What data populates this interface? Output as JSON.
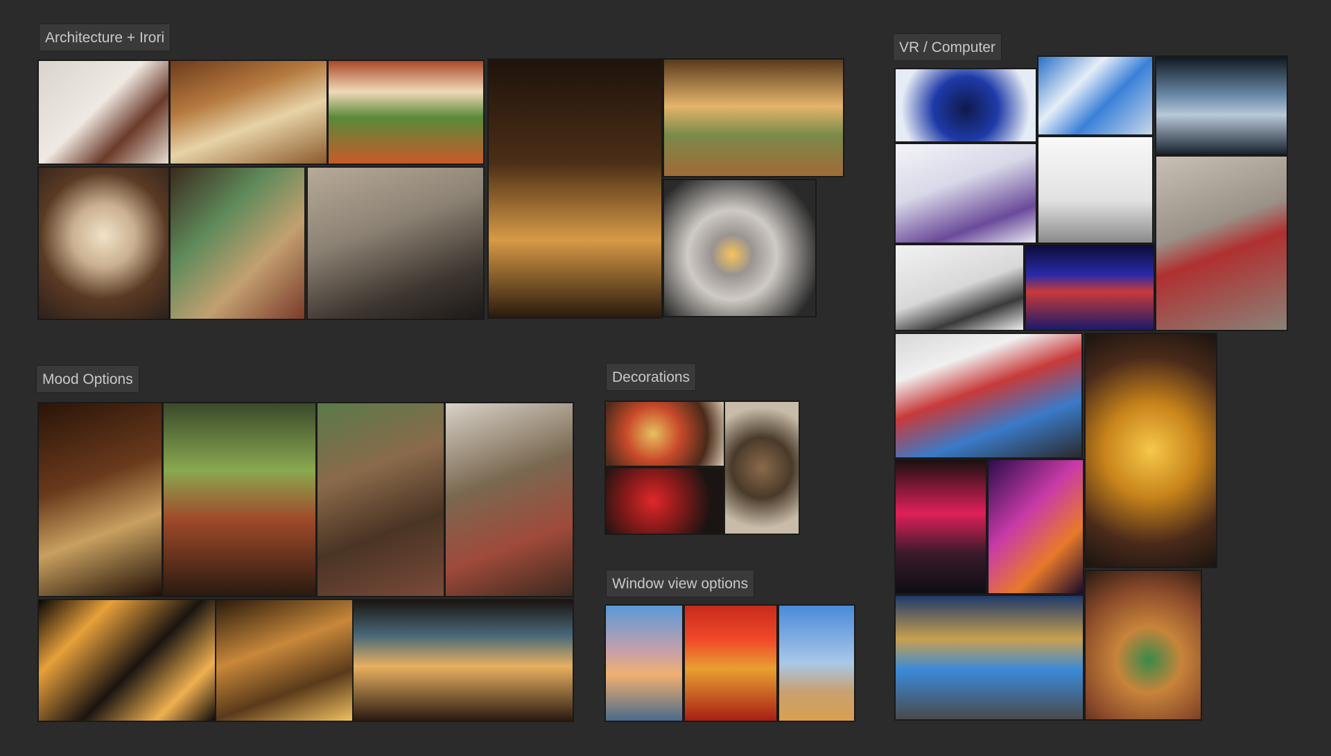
{
  "groups": {
    "architecture": {
      "title": "Architecture + Irori",
      "images": [
        {
          "name": "circle-window-living-room-image",
          "bg": "linear-gradient(135deg,#d9d4cc 0%,#efe9e2 45%,#6b3a2a 70%,#e6ddd0 100%)"
        },
        {
          "name": "tatami-garden-room-image",
          "bg": "linear-gradient(160deg,#6e3b1c 0%,#b57a3f 35%,#e7d3a8 60%,#8b5a2b 100%)"
        },
        {
          "name": "shoji-garden-view-image",
          "bg": "linear-gradient(180deg,#a84a2a 0%,#f1d9b8 30%,#5a8a3a 55%,#c85a2a 100%)"
        },
        {
          "name": "dark-irori-hall-image",
          "bg": "linear-gradient(180deg,#1e130b 0%,#4b2e16 40%,#d79a46 70%,#2a1a0e 100%)"
        },
        {
          "name": "hanging-hood-irori-room-image",
          "bg": "linear-gradient(180deg,#5a3a1e 0%,#e4b46a 40%,#7a8a4a 65%,#a06a36 100%)"
        },
        {
          "name": "round-moon-door-bonsai-image",
          "bg": "radial-gradient(circle at 50% 45%,#f2e2c8 0%,#c9b090 30%,#5a3a24 60%,#2c2019 100%)"
        },
        {
          "name": "green-moon-bedroom-image",
          "bg": "linear-gradient(135deg,#3a2a1c 0%,#5f8a5a 35%,#c2a070 65%,#7a3a2a 100%)"
        },
        {
          "name": "sunken-tatami-irori-image",
          "bg": "linear-gradient(160deg,#b8aa98 0%,#8c8274 40%,#3e3630 75%,#1e1a18 100%)"
        },
        {
          "name": "circular-fire-pit-lounge-image",
          "bg": "radial-gradient(circle at 45% 55%,#f6c35a 0%,#9a9490 18%,#cfcac4 40%,#2a2a2a 80%)"
        }
      ]
    },
    "vr_computer": {
      "title": "VR / Computer",
      "images": [
        {
          "name": "vr-pod-chair-image",
          "bg": "radial-gradient(circle at 50% 55%,#0f1a4a 0%,#1e3aa8 40%,#e6ecf5 80%)"
        },
        {
          "name": "vr-flight-rig-image",
          "bg": "linear-gradient(135deg,#2a70c8 0%,#e6eef8 35%,#3a80d8 60%,#c8d8ea 100%)"
        },
        {
          "name": "server-cables-image",
          "bg": "linear-gradient(180deg,#101820 0%,#6a8aa8 40%,#b8c8d8 60%,#1a2430 100%)"
        },
        {
          "name": "vr-swing-arcade-image",
          "bg": "linear-gradient(160deg,#f4f4f8 0%,#d8d8e8 40%,#6a4a9a 75%,#e8e8f0 100%)"
        },
        {
          "name": "vr-treadmill-jump-image",
          "bg": "linear-gradient(180deg,#f8f8f8 0%,#e2e2e2 60%,#8a8a8a 100%)"
        },
        {
          "name": "cable-floor-room-image",
          "bg": "linear-gradient(160deg,#c8c0b4 0%,#9a9288 40%,#b03030 55%,#8a8278 100%)"
        },
        {
          "name": "vr-body-rig-image",
          "bg": "linear-gradient(160deg,#f2f2f2 0%,#d8d8d8 50%,#3a3a3a 75%,#eeeeee 100%)"
        },
        {
          "name": "server-rack-lights-image",
          "bg": "linear-gradient(180deg,#0c0c3a 0%,#2a2aa8 35%,#c83a3a 55%,#1a1a6a 100%)"
        },
        {
          "name": "electrical-panel-image",
          "bg": "linear-gradient(160deg,#d8d8d8 0%,#f0f0f0 25%,#c83a3a 45%,#3a7ac8 70%,#2a2a2a 100%)"
        },
        {
          "name": "quantum-chandelier-image",
          "bg": "radial-gradient(circle at 50% 50%,#f6c84a 0%,#c8841a 35%,#4a2a1a 70%,#1a1410 100%)"
        },
        {
          "name": "neon-katakana-sign-image",
          "bg": "linear-gradient(180deg,#1a1010 0%,#e0205a 40%,#3a1a2a 70%,#0e0e14 100%)"
        },
        {
          "name": "neon-poster-art-image",
          "bg": "linear-gradient(135deg,#2a0e4a 0%,#c83aa8 40%,#e87a2a 70%,#1a0a2a 100%)"
        },
        {
          "name": "quantum-computer-lab-image",
          "bg": "linear-gradient(180deg,#1e3a6a 0%,#c8a050 35%,#3a8ad8 60%,#4a4a4a 100%)"
        },
        {
          "name": "quantum-chip-cables-image",
          "bg": "radial-gradient(circle at 55% 60%,#3a8a4a 0%,#c8843a 30%,#8a4a2a 65%,#2a1a12 100%)"
        }
      ]
    },
    "mood": {
      "title": "Mood Options",
      "images": [
        {
          "name": "dark-wood-sitting-room-image",
          "bg": "linear-gradient(160deg,#2a1408 0%,#6a3a1c 40%,#c8a060 65%,#1e0e06 100%)"
        },
        {
          "name": "courtyard-pond-image",
          "bg": "linear-gradient(180deg,#3a4a2a 0%,#8aa850 35%,#a04a2a 60%,#2a1a10 100%)"
        },
        {
          "name": "library-tree-room-image",
          "bg": "linear-gradient(160deg,#5a7a4a 0%,#8a6a4a 35%,#4a3424 65%,#7a4a3a 100%)"
        },
        {
          "name": "gabled-window-study-image",
          "bg": "linear-gradient(160deg,#d8d2c8 0%,#7a6850 40%,#a04a3a 70%,#3a2a1e 100%)"
        },
        {
          "name": "lantern-lit-room-image",
          "bg": "linear-gradient(135deg,#0a0806 0%,#e8a03a 25%,#1a1410 55%,#f0b050 80%,#0e0a08 100%)"
        },
        {
          "name": "samurai-hall-image",
          "bg": "linear-gradient(160deg,#2a1a0c 0%,#c8883a 40%,#5a3a1a 70%,#f0c060 100%)"
        },
        {
          "name": "dojo-floor-reflection-image",
          "bg": "linear-gradient(180deg,#1a1410 0%,#4a6a7a 30%,#e8b060 55%,#2a1a10 100%)"
        }
      ]
    },
    "decorations": {
      "title": "Decorations",
      "images": [
        {
          "name": "ornate-shields-image",
          "bg": "radial-gradient(circle at 40% 50%,#e8c060 0%,#c84a2a 35%,#4a2a1a 70%,#d8c8b0 100%)"
        },
        {
          "name": "buddha-statue-image",
          "bg": "radial-gradient(circle at 50% 50%,#8a6a4a 0%,#4a3a2a 40%,#c8bca8 80%)"
        },
        {
          "name": "samurai-armor-image",
          "bg": "radial-gradient(circle at 40% 50%,#e0282a 0%,#8a1a1a 35%,#1a1412 75%)"
        }
      ]
    },
    "window_view": {
      "title": "Window view options",
      "images": [
        {
          "name": "city-sunset-skyline-image",
          "bg": "linear-gradient(180deg,#5a9ad8 0%,#c8a0a8 40%,#f0b070 60%,#4a6a8a 100%)"
        },
        {
          "name": "autumn-temple-image",
          "bg": "linear-gradient(180deg,#c82a1a 0%,#f04a2a 30%,#e8a030 55%,#a81e14 100%)"
        },
        {
          "name": "twisted-tree-sky-image",
          "bg": "linear-gradient(180deg,#4a8ad8 0%,#a8c8e8 50%,#c8a070 75%,#d8a050 100%)"
        }
      ]
    }
  }
}
